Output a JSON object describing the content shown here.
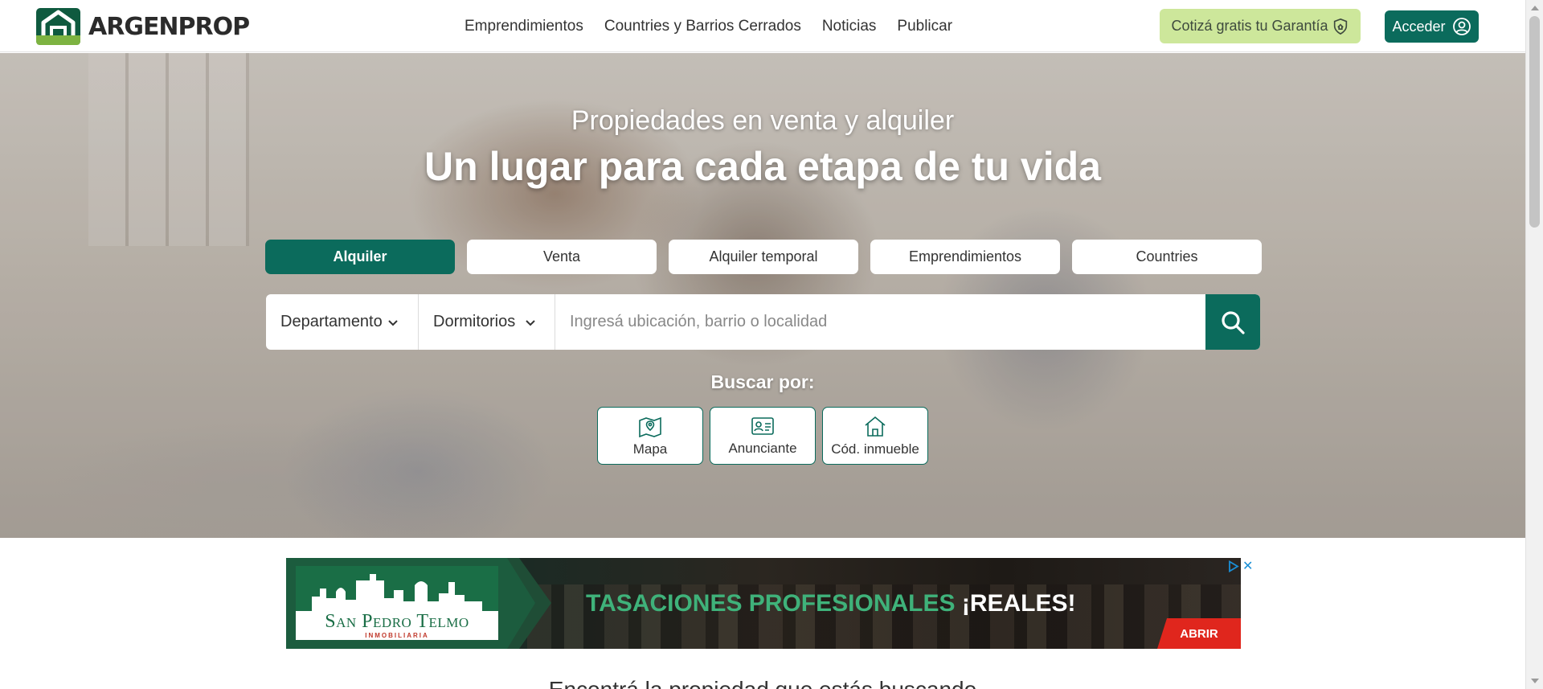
{
  "brand": {
    "name": "ARGENPROP",
    "logo_icon": "house-logo-icon",
    "primary_color": "#0b6b5c",
    "accent_color": "#cde79b"
  },
  "nav": {
    "items": [
      {
        "label": "Emprendimientos"
      },
      {
        "label": "Countries y Barrios Cerrados"
      },
      {
        "label": "Noticias"
      },
      {
        "label": "Publicar"
      }
    ]
  },
  "header_actions": {
    "garantia_label": "Cotizá gratis tu Garantía",
    "garantia_icon": "shield-icon",
    "acceder_label": "Acceder",
    "acceder_icon": "user-circle-icon"
  },
  "hero": {
    "subtitle": "Propiedades en venta y alquiler",
    "title": "Un lugar para cada etapa de tu vida"
  },
  "tabs": [
    {
      "label": "Alquiler",
      "active": true
    },
    {
      "label": "Venta",
      "active": false
    },
    {
      "label": "Alquiler temporal",
      "active": false
    },
    {
      "label": "Emprendimientos",
      "active": false
    },
    {
      "label": "Countries",
      "active": false
    }
  ],
  "search": {
    "property_type": "Departamento",
    "bedrooms": "Dormitorios",
    "placeholder": "Ingresá ubicación, barrio o localidad",
    "button_icon": "search-icon"
  },
  "search_by": {
    "label": "Buscar por:",
    "options": [
      {
        "label": "Mapa",
        "icon": "map-pin-icon"
      },
      {
        "label": "Anunciante",
        "icon": "id-card-icon"
      },
      {
        "label": "Cód. inmueble",
        "icon": "house-icon"
      }
    ]
  },
  "ad": {
    "logo_name": "San Pedro Telmo",
    "logo_sub": "INMOBILIARIA",
    "headline_1": "TASACIONES PROFESIONALES",
    "headline_2": "¡REALES!",
    "cta": "ABRIR",
    "choices_icon": "adchoices-icon",
    "close_label": "✕"
  },
  "bottom_text": "Encontrá la propiedad que estás buscando"
}
